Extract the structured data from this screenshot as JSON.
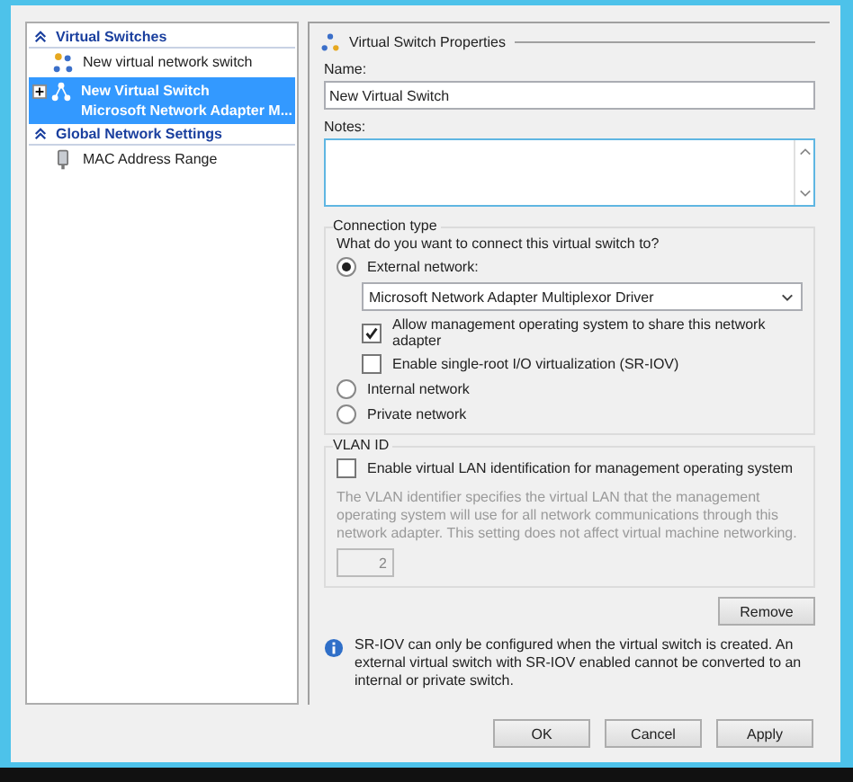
{
  "sidebar": {
    "sections": [
      {
        "title": "Virtual Switches",
        "expanded": true,
        "items": [
          {
            "kind": "add",
            "label": "New virtual network switch",
            "selected": false
          },
          {
            "kind": "switch",
            "label": "New Virtual Switch",
            "sublabel": "Microsoft Network Adapter M...",
            "selected": true,
            "expanded": false
          }
        ]
      },
      {
        "title": "Global Network Settings",
        "expanded": true,
        "items": [
          {
            "kind": "mac",
            "label": "MAC Address Range",
            "selected": false
          }
        ]
      }
    ]
  },
  "properties": {
    "title": "Virtual Switch Properties",
    "name_label": "Name:",
    "name_value": "New Virtual Switch",
    "notes_label": "Notes:",
    "connection_type": {
      "title": "Connection type",
      "question": "What do you want to connect this virtual switch to?",
      "options": [
        {
          "label": "External network:",
          "selected": true
        },
        {
          "label": "Internal network",
          "selected": false
        },
        {
          "label": "Private network",
          "selected": false
        }
      ],
      "adapter": "Microsoft Network Adapter Multiplexor Driver",
      "checkboxes": [
        {
          "label": "Allow management operating system to share this network adapter",
          "checked": true
        },
        {
          "label": "Enable single-root I/O virtualization (SR-IOV)",
          "checked": false
        }
      ]
    },
    "vlan": {
      "title": "VLAN ID",
      "checkbox": {
        "label": "Enable virtual LAN identification for management operating system",
        "checked": false
      },
      "description": "The VLAN identifier specifies the virtual LAN that the management operating system will use for all network communications through this network adapter. This setting does not affect virtual machine networking.",
      "value": "2",
      "disabled": true
    },
    "remove_button": "Remove",
    "info": "SR-IOV can only be configured when the virtual switch is created. An external virtual switch with SR-IOV enabled cannot be converted to an internal or private switch."
  },
  "buttons": [
    "OK",
    "Cancel",
    "Apply"
  ]
}
